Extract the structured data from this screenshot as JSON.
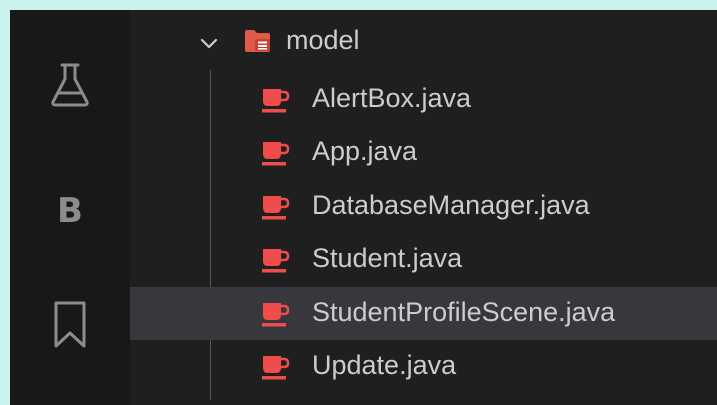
{
  "colors": {
    "background": "#c9f1ee",
    "activity_bar": "#181818",
    "sidebar": "#1f1f1f",
    "selected_row": "#37373d",
    "text": "#cccccc",
    "icon": "#8c8c8c",
    "java_icon": "#f14c4c"
  },
  "activity_bar": {
    "items": [
      {
        "icon": "flask-icon"
      },
      {
        "icon": "b-letter-icon",
        "label": "B"
      },
      {
        "icon": "bookmark-icon"
      }
    ]
  },
  "explorer": {
    "folder": {
      "name": "model",
      "expanded": true,
      "icon": "folder-open-icon"
    },
    "files": [
      {
        "name": "AlertBox.java",
        "icon": "java-coffee-icon",
        "selected": false
      },
      {
        "name": "App.java",
        "icon": "java-coffee-icon",
        "selected": false
      },
      {
        "name": "DatabaseManager.java",
        "icon": "java-coffee-icon",
        "selected": false
      },
      {
        "name": "Student.java",
        "icon": "java-coffee-icon",
        "selected": false
      },
      {
        "name": "StudentProfileScene.java",
        "icon": "java-coffee-icon",
        "selected": true
      },
      {
        "name": "Update.java",
        "icon": "java-coffee-icon",
        "selected": false
      }
    ]
  }
}
